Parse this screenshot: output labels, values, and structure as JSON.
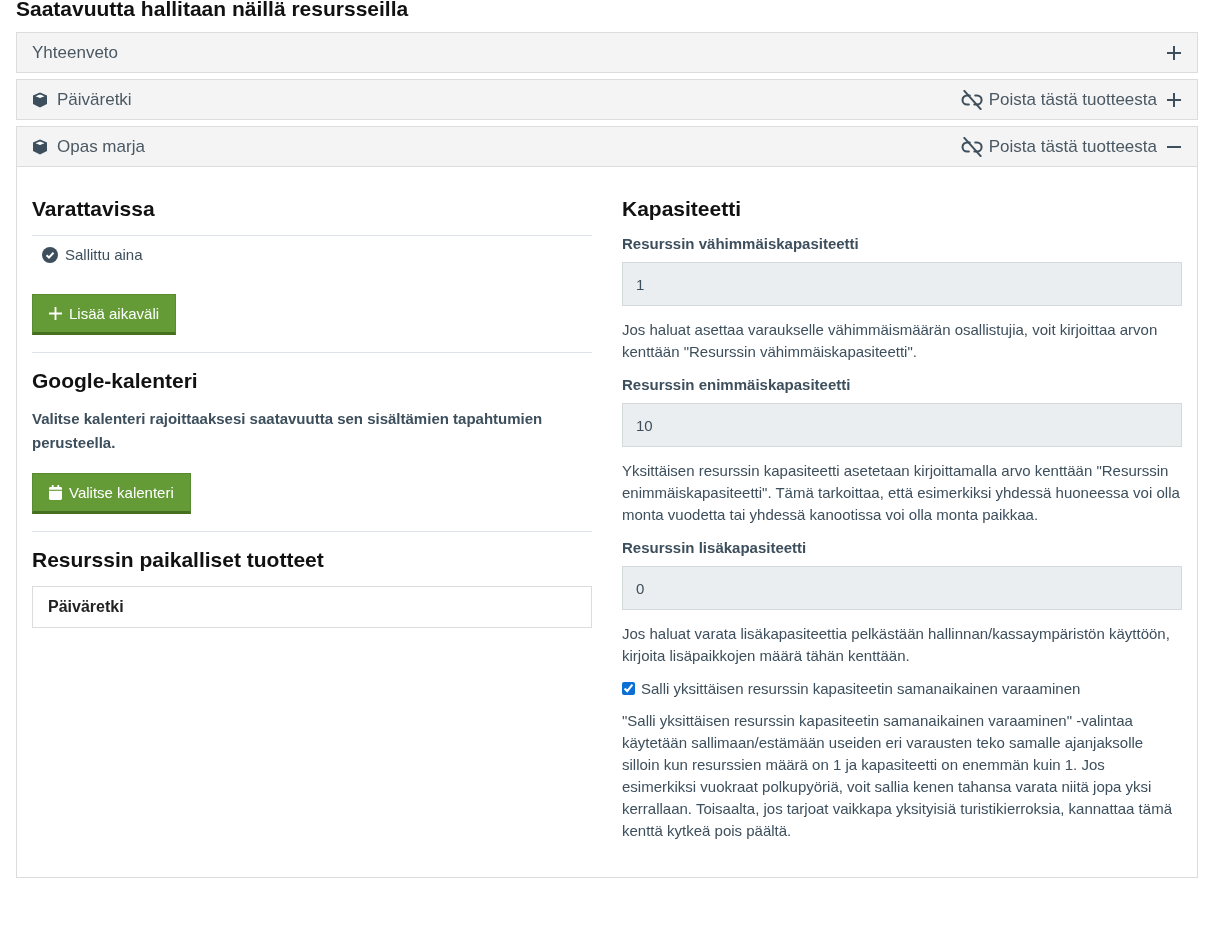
{
  "page_title": "Saatavuutta hallitaan näillä resursseilla",
  "panels": [
    {
      "kind": "summary",
      "title": "Yhteenveto",
      "expanded": false
    },
    {
      "kind": "product",
      "title": "Päiväretki",
      "remove_link": "Poista tästä tuotteesta",
      "expanded": false
    },
    {
      "kind": "product",
      "title": "Opas marja",
      "remove_link": "Poista tästä tuotteesta",
      "expanded": true,
      "content": {
        "availability": {
          "heading": "Varattavissa",
          "rules": [
            "Sallittu aina"
          ],
          "add_button": "Lisää aikaväli"
        },
        "google_calendar": {
          "heading": "Google-kalenteri",
          "description": "Valitse kalenteri rajoittaaksesi saatavuutta sen sisältämien tapahtumien perusteella.",
          "button": "Valitse kalenteri"
        },
        "local_products": {
          "heading": "Resurssin paikalliset tuotteet",
          "items": [
            "Päiväretki"
          ]
        },
        "capacity": {
          "heading": "Kapasiteetti",
          "fields": [
            {
              "label": "Resurssin vähimmäiskapasiteetti",
              "value": "1",
              "help": "Jos haluat asettaa varaukselle vähimmäismäärän osallistujia, voit kirjoittaa arvon kenttään \"Resurssin vähimmäiskapasiteetti\"."
            },
            {
              "label": "Resurssin enimmäiskapasiteetti",
              "value": "10",
              "help": "Yksittäisen resurssin kapasiteetti asetetaan kirjoittamalla arvo kenttään \"Resurssin enimmäiskapasiteetti\". Tämä tarkoittaa, että esimerkiksi yhdessä huoneessa voi olla monta vuodetta tai yhdessä kanootissa voi olla monta paikkaa."
            },
            {
              "label": "Resurssin lisäkapasiteetti",
              "value": "0",
              "help": "Jos haluat varata lisäkapasiteettia pelkästään hallinnan/kassaympäristön käyttöön, kirjoita lisäpaikkojen määrä tähän kenttään."
            }
          ],
          "checkbox": {
            "label": "Salli yksittäisen resurssin kapasiteetin samanaikainen varaaminen",
            "checked": true
          },
          "checkbox_help": "\"Salli yksittäisen resurssin kapasiteetin samanaikainen varaaminen\" -valintaa käytetään sallimaan/estämään useiden eri varausten teko samalle ajanjaksolle silloin kun resurssien määrä on 1 ja kapasiteetti on enemmän kuin 1. Jos esimerkiksi vuokraat polkupyöriä, voit sallia kenen tahansa varata niitä jopa yksi kerrallaan. Toisaalta, jos tarjoat vaikkapa yksityisiä turistikierroksia, kannattaa tämä kenttä kytkeä pois päältä."
        }
      }
    }
  ]
}
